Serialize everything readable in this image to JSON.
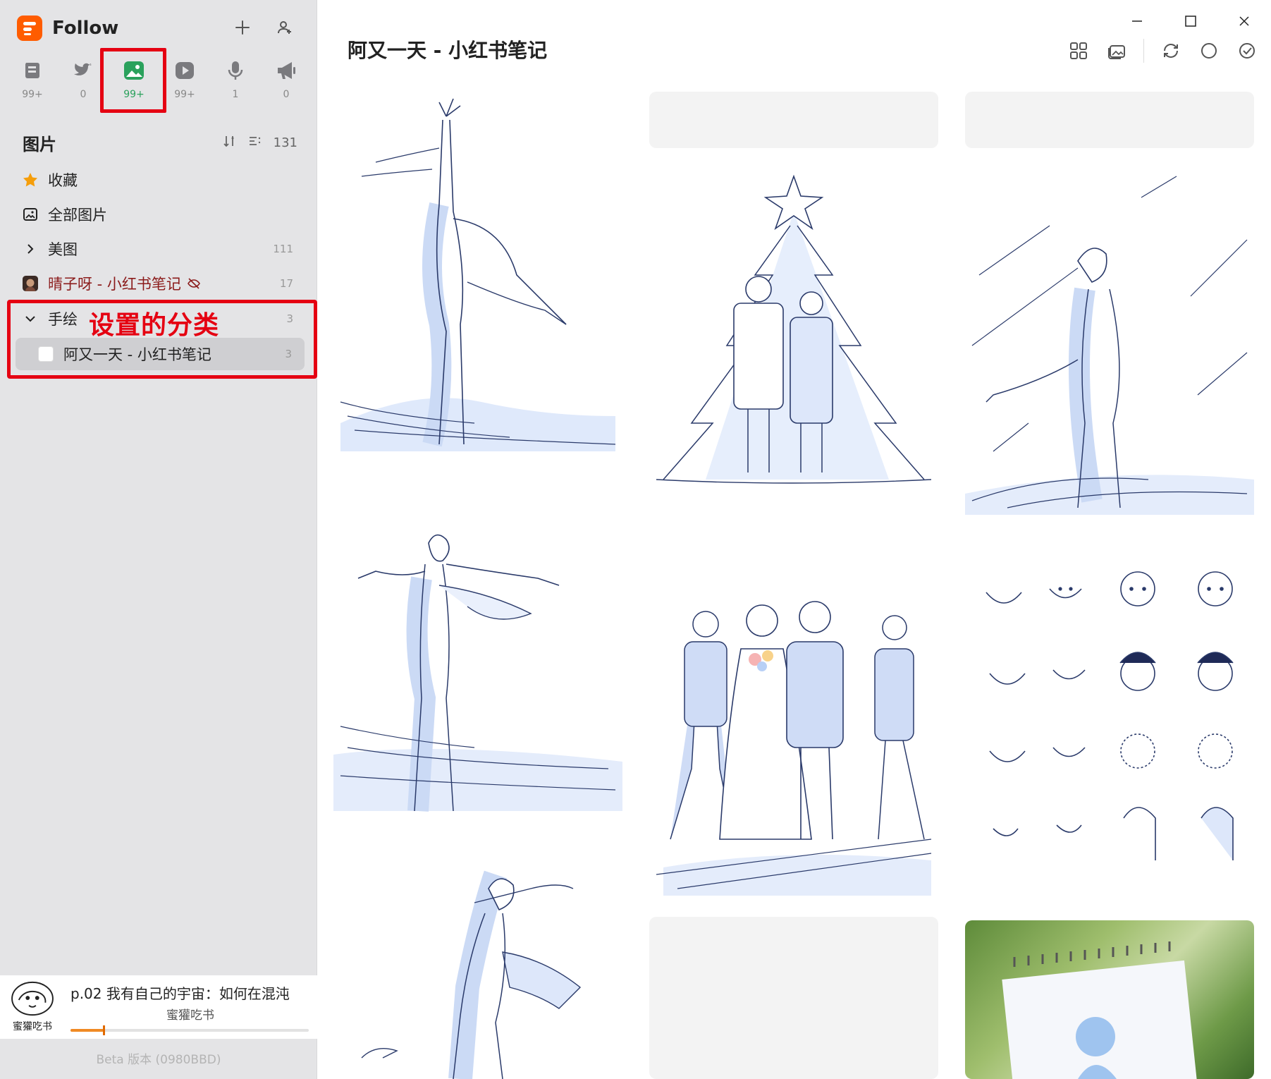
{
  "app": {
    "name": "Follow"
  },
  "view_tabs": [
    {
      "icon": "article-icon",
      "count": "99+"
    },
    {
      "icon": "twitter-icon",
      "count": "0"
    },
    {
      "icon": "image-icon",
      "count": "99+",
      "active": true
    },
    {
      "icon": "video-icon",
      "count": "99+"
    },
    {
      "icon": "microphone-icon",
      "count": "1"
    },
    {
      "icon": "megaphone-icon",
      "count": "0"
    }
  ],
  "colors": {
    "accent": "#ff5c00",
    "active_view": "#2aa15c",
    "annotation": "#e50012"
  },
  "section": {
    "title": "图片",
    "total": "131"
  },
  "nav": {
    "favorites": "收藏",
    "all_images": "全部图片",
    "meitu": {
      "label": "美图",
      "count": "111"
    },
    "qingziya": {
      "label": "晴子呀 - 小红书笔记",
      "count": "17"
    },
    "shouhui": {
      "label": "手绘",
      "count": "3"
    },
    "ayouyitian": {
      "label": "阿又一天 - 小红书笔记",
      "count": "3"
    }
  },
  "annotation": {
    "category_note": "设置的分类"
  },
  "player": {
    "cover_label": "蜜獾吃书",
    "title": "p.02 我有自己的宇宙：如何在混沌",
    "subtitle": "蜜獾吃书",
    "progress": 0.14
  },
  "footer": {
    "version": "Beta 版本 (0980BBD)"
  },
  "main": {
    "title": "阿又一天 - 小红书笔记"
  }
}
